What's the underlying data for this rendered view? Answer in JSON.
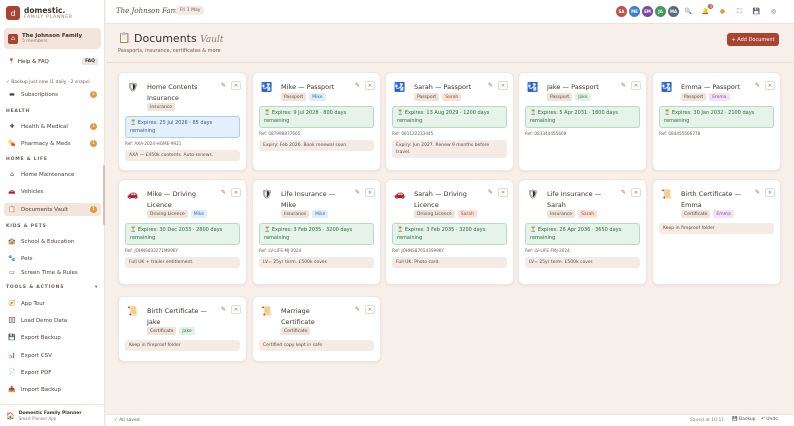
{
  "brand": {
    "logo": "d",
    "name": "domestic.",
    "sub": "FAMILY PLANNER"
  },
  "family": {
    "name": "The Johnson Family",
    "members": "5 members"
  },
  "help": {
    "label": "Help & FAQ",
    "badge": "FAQ"
  },
  "backup_note": "✓ Backup just now (1 daily · 2 snaps)",
  "nav": {
    "subscriptions": {
      "label": "Subscriptions",
      "badge": "2"
    },
    "health_header": "HEALTH",
    "health_medical": {
      "label": "Health & Medical",
      "badge": "1"
    },
    "pharmacy": {
      "label": "Pharmacy & Meds",
      "badge": "1"
    },
    "home_header": "HOME & LIFE",
    "home_maintenance": {
      "label": "Home Maintenance"
    },
    "vehicles": {
      "label": "Vehicles"
    },
    "documents": {
      "label": "Documents Vault",
      "badge": "1"
    },
    "kids_header": "KIDS & PETS",
    "school": {
      "label": "School & Education"
    },
    "pets": {
      "label": "Pets"
    },
    "screen_time": {
      "label": "Screen Time & Rules"
    },
    "tools_header": "TOOLS & ACTIONS",
    "app_tour": {
      "label": "App Tour"
    },
    "load_demo": {
      "label": "Load Demo Data"
    },
    "export_backup": {
      "label": "Export Backup"
    },
    "export_csv": {
      "label": "Export CSV"
    },
    "export_pdf": {
      "label": "Export PDF"
    },
    "import_backup": {
      "label": "Import Backup"
    }
  },
  "sidebar_footer": {
    "name": "Domestic Family Planner",
    "sub": "Smart Planner App"
  },
  "topbar": {
    "title": "The Johnson Family",
    "date": "Fri 1 May",
    "avatars": [
      {
        "initials": "SA",
        "color": "#c0504a"
      },
      {
        "initials": "ME",
        "color": "#3f7fd0"
      },
      {
        "initials": "EM",
        "color": "#7b4aa0"
      },
      {
        "initials": "JA",
        "color": "#3f9a5a"
      },
      {
        "initials": "MA",
        "color": "#5b6b7b"
      }
    ],
    "notif_count": "4"
  },
  "header": {
    "title": "Documents",
    "title_accent": "Vault",
    "subtitle": "Passports, insurance, certificates & more",
    "add_button": "+ Add Document"
  },
  "cards": [
    {
      "icon": "🛡",
      "title": "Home Contents Insurance",
      "tags": [
        "Insurance"
      ],
      "person": "",
      "expiry": "⏳ Expires: 25 Jul 2026 · 85 days remaining",
      "expiry_style": "blue",
      "ref": "Ref: AXA-2024-HOME-9921",
      "note": "AXA — £450k contents. Auto-renews."
    },
    {
      "icon": "🛂",
      "title": "Mike — Passport",
      "tags": [
        "Passport"
      ],
      "person": "Mike",
      "expiry": "⏳ Expires: 9 Jul 2028 · 800 days remaining",
      "expiry_style": "green",
      "ref": "Ref: 087998877665",
      "note": "Expiry: Feb 2026. Book renewal soon."
    },
    {
      "icon": "🛂",
      "title": "Sarah — Passport",
      "tags": [
        "Passport"
      ],
      "person": "Sarah",
      "expiry": "⏳ Expires: 13 Aug 2029 · 1200 days remaining",
      "expiry_style": "green",
      "ref": "Ref: 081122233445",
      "note": "Expiry: Jun 2027. Renew 9 months before travel."
    },
    {
      "icon": "🛂",
      "title": "Jake — Passport",
      "tags": [
        "Passport"
      ],
      "person": "Jake",
      "expiry": "⏳ Expires: 5 Apr 2031 · 1800 days remaining",
      "expiry_style": "green",
      "ref": "Ref: 083344455669",
      "note": ""
    },
    {
      "icon": "🛂",
      "title": "Emma — Passport",
      "tags": [
        "Passport"
      ],
      "person": "Emma",
      "expiry": "⏳ Expires: 30 Jan 2032 · 2100 days remaining",
      "expiry_style": "green",
      "ref": "Ref: 084455566778",
      "note": ""
    },
    {
      "icon": "🚗",
      "title": "Mike — Driving Licence",
      "tags": [
        "Driving Licence"
      ],
      "person": "Mike",
      "expiry": "⏳ Expires: 30 Dec 2033 · 2800 days remaining",
      "expiry_style": "green",
      "ref": "Ref: JOHNS833271M99KY",
      "note": "Full UK + trailer entitlement."
    },
    {
      "icon": "🛡",
      "title": "Life Insurance — Mike",
      "tags": [
        "Insurance"
      ],
      "person": "Mike",
      "expiry": "⏳ Expires: 3 Feb 2035 · 3200 days remaining",
      "expiry_style": "green",
      "ref": "Ref: LV-LIFE-MJ-2024",
      "note": "LV= 25yr term. £500k cover."
    },
    {
      "icon": "🚗",
      "title": "Sarah — Driving Licence",
      "tags": [
        "Driving Licence"
      ],
      "person": "Sarah",
      "expiry": "⏳ Expires: 3 Feb 2035 · 3200 days remaining",
      "expiry_style": "green",
      "ref": "Ref: JOHNS876543S99KY",
      "note": "Full UK. Photo card."
    },
    {
      "icon": "🛡",
      "title": "Life Insurance — Sarah",
      "tags": [
        "Insurance"
      ],
      "person": "Sarah",
      "expiry": "⏳ Expires: 26 Apr 2036 · 3650 days remaining",
      "expiry_style": "green",
      "ref": "Ref: LV-LIFE-FMJ-2024",
      "note": "LV= 25yr term. £500k cover."
    },
    {
      "icon": "📜",
      "title": "Birth Certificate — Emma",
      "tags": [
        "Certificate"
      ],
      "person": "Emma",
      "expiry": "",
      "expiry_style": "",
      "ref": "",
      "note": "Keep in fireproof folder"
    },
    {
      "icon": "📜",
      "title": "Birth Certificate — Jake",
      "tags": [
        "Certificate"
      ],
      "person": "Jake",
      "expiry": "",
      "expiry_style": "",
      "ref": "",
      "note": "Keep in fireproof folder"
    },
    {
      "icon": "📜",
      "title": "Marriage Certificate",
      "tags": [
        "Certificate"
      ],
      "person": "",
      "expiry": "",
      "expiry_style": "",
      "ref": "",
      "note": "Certified copy kept in safe"
    }
  ],
  "statusbar": {
    "saved": "✓ All saved",
    "saved_at": "Saved at 10:11",
    "backup": "💾 Backup",
    "undo": "↶ Undo"
  }
}
